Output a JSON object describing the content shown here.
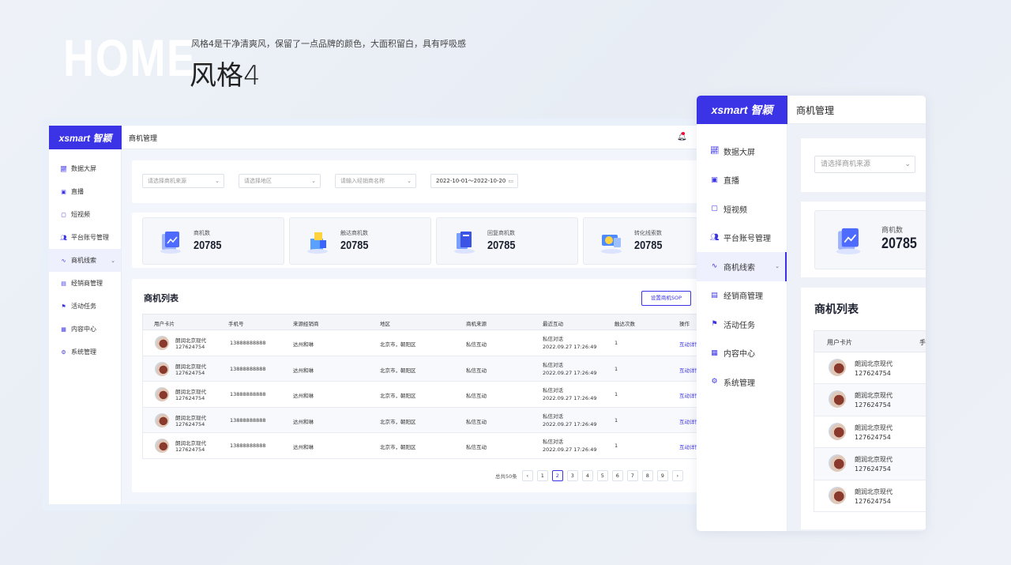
{
  "hero": {
    "home": "HOME",
    "description": "风格4是干净清爽风，保留了一点品牌的颜色，大面积留白，具有呼吸感",
    "style_title": "风格4"
  },
  "app": {
    "logo": "xsmart 智颖",
    "page_title": "商机管理",
    "sidebar": [
      {
        "label": "数据大屏",
        "icon": "chart-icon"
      },
      {
        "label": "直播",
        "icon": "live-icon"
      },
      {
        "label": "短视频",
        "icon": "video-icon"
      },
      {
        "label": "平台账号管理",
        "icon": "users-icon"
      },
      {
        "label": "商机线索",
        "icon": "leads-icon",
        "active": true
      },
      {
        "label": "经销商管理",
        "icon": "dealer-icon"
      },
      {
        "label": "活动任务",
        "icon": "flag-icon"
      },
      {
        "label": "内容中心",
        "icon": "grid-icon"
      },
      {
        "label": "系统管理",
        "icon": "gear-icon"
      }
    ],
    "filters": {
      "source_placeholder": "请选择商机来源",
      "region_placeholder": "请选择地区",
      "dealer_placeholder": "请输入经销商名称",
      "date_range": "2022-10-01～2022-10-20"
    },
    "stats": [
      {
        "label": "商机数",
        "value": "20785"
      },
      {
        "label": "触达商机数",
        "value": "20785"
      },
      {
        "label": "回复商机数",
        "value": "20785"
      },
      {
        "label": "转化线索数",
        "value": "20785"
      }
    ],
    "list": {
      "title": "商机列表",
      "sop_button": "设置商机SOP",
      "columns": [
        "用户卡片",
        "手机号",
        "来源经销商",
        "地区",
        "商机来源",
        "最近互动",
        "触达次数",
        "操作"
      ],
      "rows": [
        {
          "name": "朗润北京现代",
          "id": "127624754",
          "phone": "13888888888",
          "dealer": "达州和琳",
          "region": "北京市，朝阳区",
          "source": "私信互动",
          "recent_type": "私信对话",
          "recent_time": "2022.09.27  17:26:49",
          "count": "1",
          "action": "互动详情"
        },
        {
          "name": "朗润北京现代",
          "id": "127624754",
          "phone": "13888888888",
          "dealer": "达州和琳",
          "region": "北京市，朝阳区",
          "source": "私信互动",
          "recent_type": "私信对话",
          "recent_time": "2022.09.27  17:26:49",
          "count": "1",
          "action": "互动详情"
        },
        {
          "name": "朗润北京现代",
          "id": "127624754",
          "phone": "13888888888",
          "dealer": "达州和琳",
          "region": "北京市，朝阳区",
          "source": "私信互动",
          "recent_type": "私信对话",
          "recent_time": "2022.09.27  17:26:49",
          "count": "1",
          "action": "互动详情"
        },
        {
          "name": "朗润北京现代",
          "id": "127624754",
          "phone": "13888888888",
          "dealer": "达州和琳",
          "region": "北京市，朝阳区",
          "source": "私信互动",
          "recent_type": "私信对话",
          "recent_time": "2022.09.27  17:26:49",
          "count": "1",
          "action": "互动详情"
        },
        {
          "name": "朗润北京现代",
          "id": "127624754",
          "phone": "13888888888",
          "dealer": "达州和琳",
          "region": "北京市，朝阳区",
          "source": "私信互动",
          "recent_type": "私信对话",
          "recent_time": "2022.09.27  17:26:49",
          "count": "1",
          "action": "互动详情"
        }
      ],
      "pagination": {
        "total": "总共50条",
        "prev": "‹",
        "next": "›",
        "pages": [
          "1",
          "2",
          "3",
          "4",
          "5",
          "6",
          "7",
          "8",
          "9"
        ],
        "current": "2"
      }
    }
  },
  "colors": {
    "brand": "#3b33e6",
    "background": "#eef2f8"
  }
}
